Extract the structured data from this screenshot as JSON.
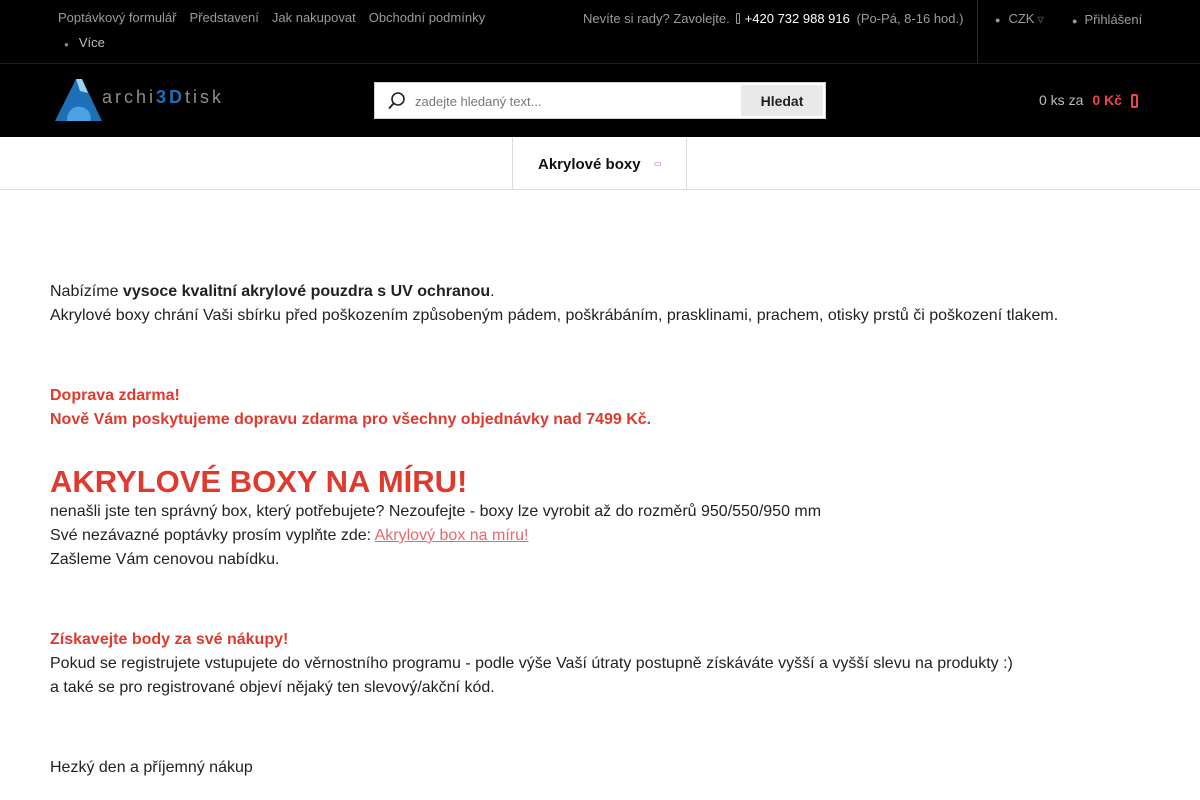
{
  "header": {
    "top_links": [
      "Poptávkový formulář",
      "Představení",
      "Jak nakupovat",
      "Obchodní podmínky"
    ],
    "more_label": "Více",
    "contact_prompt": "Nevíte si rady? Zavolejte.",
    "phone": "+420 732 988 916",
    "hours": "(Po-Pá, 8-16 hod.)",
    "currency": "CZK",
    "login_label": "Přihlášení"
  },
  "logo": {
    "text_pre": "archi",
    "text_mid": "3D",
    "text_post": "tisk"
  },
  "search": {
    "placeholder": "zadejte hledaný text...",
    "button_label": "Hledat"
  },
  "cart": {
    "count_label": "0 ks za",
    "price": "0 Kč"
  },
  "nav": {
    "items": [
      "Akrylové boxy"
    ]
  },
  "content": {
    "intro_prefix": "Nabízíme ",
    "intro_bold": "vysoce kvalitní akrylové pouzdra s UV ochranou",
    "intro_suffix": ".",
    "intro_line2": "Akrylové boxy chrání Vaši sbírku před poškozením způsobeným pádem, poškrábáním, prasklinami, prachem, otisky prstů či poškození tlakem.",
    "shipping_title": "Doprava zdarma!",
    "shipping_text": "Nově Vám poskytujeme dopravu zdarma pro všechny objednávky nad 7499 Kč.",
    "custom_heading": "AKRYLOVÉ BOXY NA MÍRU!",
    "custom_line1": "nenašli jste ten správný box, který potřebujete? Nezoufejte - boxy lze vyrobit až do rozměrů 950/550/950 mm",
    "custom_line2_prefix": "Své nezávazné poptávky prosím vyplňte zde: ",
    "custom_link": "Akrylový box na míru!",
    "custom_line3": "Zašleme Vám cenovou nabídku.",
    "points_title": "Získavejte body za své nákupy!",
    "points_line1": "Pokud se registrujete vstupujete do věrnostního programu - podle výše Vaší útraty postupně získáváte vyšší a vyšší slevu na produkty :)",
    "points_line2": "a také se pro registrované objeví nějaký ten slevový/akční kód.",
    "closing": "Hezký den a příjemný nákup"
  },
  "icons": {
    "more": "more-icon",
    "phone": "phone-icon",
    "currency": "currency-icon",
    "login": "user-icon",
    "search": "search-icon",
    "cart": "cart-icon",
    "chevron": "chevron-down-icon"
  },
  "colors": {
    "accent_red": "#e03a2e",
    "link": "#e8676b",
    "logo_blue": "#1e6fb8",
    "header_bg": "#000000"
  }
}
